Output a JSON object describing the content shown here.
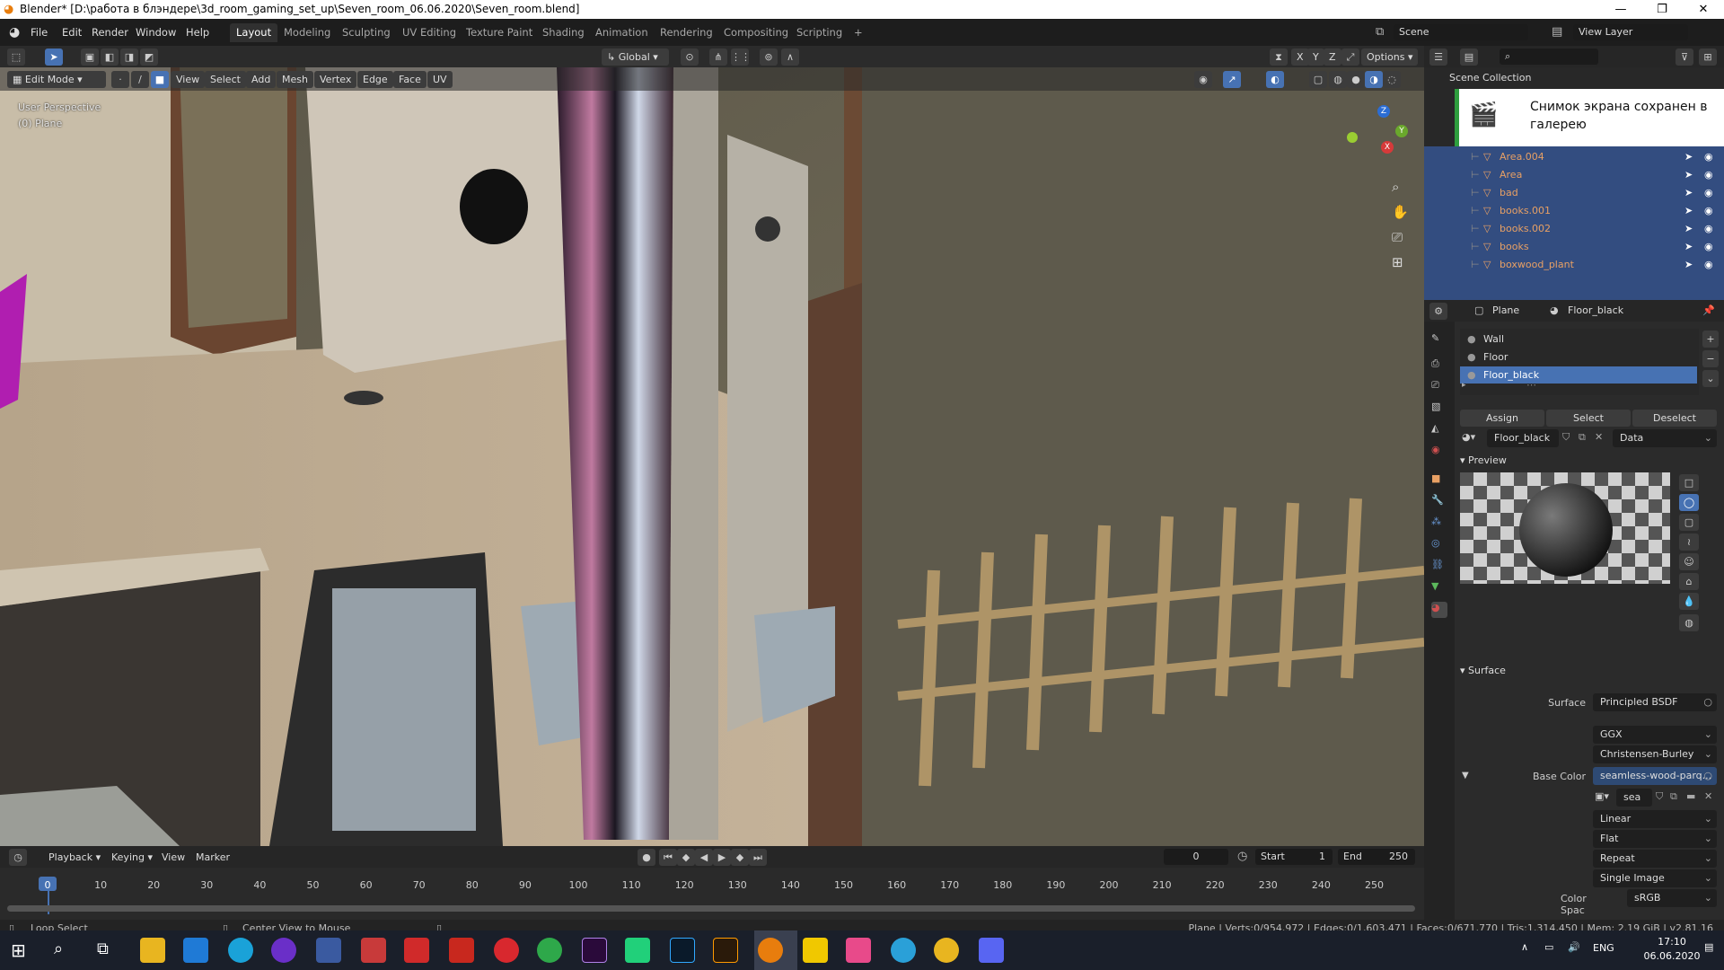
{
  "window": {
    "title": "Blender* [D:\\работа в блэндере\\3d_room_gaming_set_up\\Seven_room_06.06.2020\\Seven_room.blend]",
    "min": "—",
    "max": "❐",
    "close": "✕"
  },
  "menu": {
    "file": "File",
    "edit": "Edit",
    "render": "Render",
    "window": "Window",
    "help": "Help"
  },
  "workspaces": [
    "Layout",
    "Modeling",
    "Sculpting",
    "UV Editing",
    "Texture Paint",
    "Shading",
    "Animation",
    "Rendering",
    "Compositing",
    "Scripting"
  ],
  "add_ws": "+",
  "scene": {
    "name": "Scene",
    "view_layer": "View Layer"
  },
  "toolbar": {
    "transform": "Global",
    "options": "Options",
    "xyz": [
      "X",
      "Y",
      "Z"
    ]
  },
  "vpheader": {
    "mode": "Edit Mode",
    "view": "View",
    "select": "Select",
    "add": "Add",
    "mesh": "Mesh",
    "vertex": "Vertex",
    "edge": "Edge",
    "face": "Face",
    "uv": "UV"
  },
  "overlay": {
    "perspective": "User Perspective",
    "object": "(0) Plane"
  },
  "gizmo": {
    "x": "X",
    "y": "Y",
    "z": "Z"
  },
  "timeline": {
    "playback": "Playback",
    "keying": "Keying",
    "view": "View",
    "marker": "Marker",
    "current": "0",
    "start_label": "Start",
    "start": "1",
    "end_label": "End",
    "end": "250",
    "ticks": [
      "0",
      "10",
      "20",
      "30",
      "40",
      "50",
      "60",
      "70",
      "80",
      "90",
      "100",
      "110",
      "120",
      "130",
      "140",
      "150",
      "160",
      "170",
      "180",
      "190",
      "200",
      "210",
      "220",
      "230",
      "240",
      "250"
    ]
  },
  "status": {
    "left": "Loop Select",
    "mid": "Center View to Mouse",
    "right": "Plane | Verts:0/954,972 | Edges:0/1,603,471 | Faces:0/671,770 | Tris:1,314,450 | Mem: 2.19 GiB | v2.81.16"
  },
  "outliner": {
    "title": "Scene Collection",
    "toast": "Снимок экрана сохранен в галерею",
    "items": [
      "Area.004",
      "Area",
      "bad",
      "books.001",
      "books.002",
      "books",
      "boxwood_plant"
    ]
  },
  "props": {
    "object": "Plane",
    "material": "Floor_black",
    "slots": [
      "Wall",
      "Floor",
      "Floor_black"
    ],
    "assign": "Assign",
    "select": "Select",
    "deselect": "Deselect",
    "mat_field": "Floor_black",
    "data": "Data",
    "preview": "Preview",
    "surface_panel": "Surface",
    "surface_label": "Surface",
    "surface_value": "Principled BSDF",
    "ggx": "GGX",
    "ss": "Christensen-Burley",
    "base_color_label": "Base Color",
    "base_color": "seamless-wood-parq...",
    "tex": "sea",
    "interp": "Linear",
    "proj": "Flat",
    "ext": "Repeat",
    "src": "Single Image",
    "cs_label": "Color Spac",
    "cs": "sRGB"
  },
  "taskbar": {
    "lang": "ENG",
    "time": "17:10",
    "date": "06.06.2020"
  },
  "colors": {
    "accent": "#4772b3",
    "header": "#303030",
    "object_orange": "#e8a064",
    "outliner_sel": "#334d80"
  }
}
